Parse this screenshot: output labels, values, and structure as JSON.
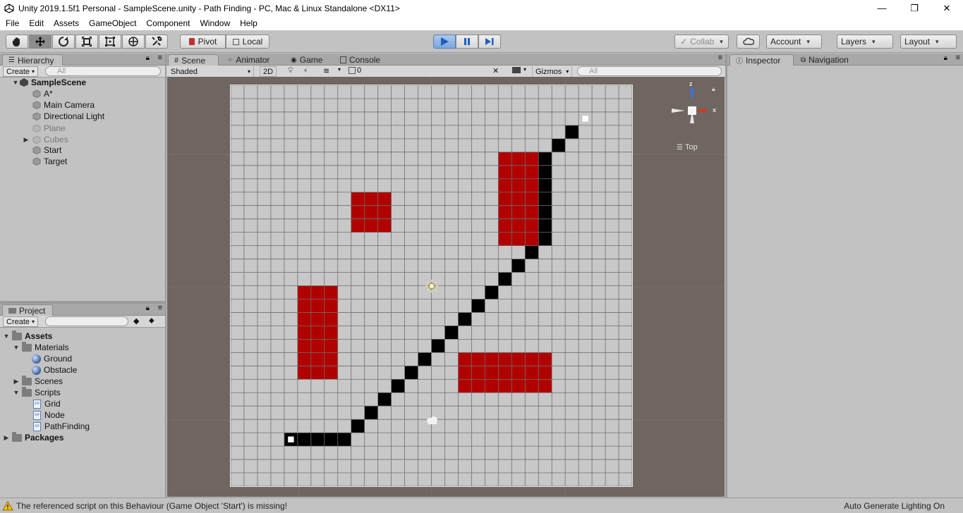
{
  "window": {
    "title": "Unity 2019.1.5f1 Personal - SampleScene.unity - Path Finding - PC, Mac & Linux Standalone <DX11>",
    "minimize": "—",
    "maximize": "❐",
    "close": "✕"
  },
  "menu": [
    "File",
    "Edit",
    "Assets",
    "GameObject",
    "Component",
    "Window",
    "Help"
  ],
  "toolbar": {
    "pivot_label": "Pivot",
    "local_label": "Local",
    "collab_label": "Collab",
    "account_label": "Account",
    "layers_label": "Layers",
    "layout_label": "Layout"
  },
  "hierarchy": {
    "tab_label": "Hierarchy",
    "create_label": "Create",
    "search_placeholder": "All",
    "scene_name": "SampleScene",
    "items": [
      {
        "label": "A*",
        "disabled": false
      },
      {
        "label": "Main Camera",
        "disabled": false
      },
      {
        "label": "Directional Light",
        "disabled": false
      },
      {
        "label": "Plane",
        "disabled": true
      },
      {
        "label": "Cubes",
        "disabled": true
      },
      {
        "label": "Start",
        "disabled": false
      },
      {
        "label": "Target",
        "disabled": false
      }
    ]
  },
  "project": {
    "tab_label": "Project",
    "create_label": "Create",
    "assets_label": "Assets",
    "materials_label": "Materials",
    "ground_label": "Ground",
    "obstacle_label": "Obstacle",
    "scenes_label": "Scenes",
    "scripts_label": "Scripts",
    "grid_label": "Grid",
    "node_label": "Node",
    "pathfinding_label": "PathFinding",
    "packages_label": "Packages",
    "cs_badge": "c#"
  },
  "scene": {
    "tabs": [
      "Scene",
      "Animator",
      "Game",
      "Console"
    ],
    "shading_label": "Shaded",
    "twod_label": "2D",
    "hidden_count": "0",
    "gizmos_label": "Gizmos",
    "search_placeholder": "All",
    "view_label": "Top",
    "axis_z": "z",
    "axis_x": "x"
  },
  "inspector": {
    "tabs": [
      "Inspector",
      "Navigation"
    ]
  },
  "status": {
    "warning_text": "The referenced script on this Behaviour (Game Object 'Start') is missing!",
    "lighting_text": "Auto Generate Lighting On"
  },
  "colors": {
    "obstacle": "#b00000",
    "path": "#000000",
    "ground": "#c8c8c8",
    "scene_bg": "#6f6561"
  },
  "grid_map": {
    "cols": 30,
    "rows": 30,
    "start": [
      4,
      26
    ],
    "target": [
      26,
      2
    ],
    "obstacles": [
      {
        "col": 9,
        "row": 8,
        "w": 3,
        "h": 3
      },
      {
        "col": 20,
        "row": 5,
        "w": 3,
        "h": 7
      },
      {
        "col": 5,
        "row": 15,
        "w": 3,
        "h": 7
      },
      {
        "col": 17,
        "row": 20,
        "w": 7,
        "h": 3
      }
    ],
    "path": [
      [
        4,
        26
      ],
      [
        5,
        26
      ],
      [
        6,
        26
      ],
      [
        7,
        26
      ],
      [
        8,
        26
      ],
      [
        9,
        25
      ],
      [
        10,
        24
      ],
      [
        11,
        23
      ],
      [
        12,
        22
      ],
      [
        13,
        21
      ],
      [
        14,
        20
      ],
      [
        15,
        19
      ],
      [
        16,
        18
      ],
      [
        17,
        17
      ],
      [
        18,
        16
      ],
      [
        19,
        15
      ],
      [
        20,
        14
      ],
      [
        21,
        13
      ],
      [
        22,
        12
      ],
      [
        23,
        11
      ],
      [
        23,
        10
      ],
      [
        23,
        9
      ],
      [
        23,
        8
      ],
      [
        23,
        7
      ],
      [
        23,
        6
      ],
      [
        23,
        5
      ],
      [
        24,
        4
      ],
      [
        25,
        3
      ]
    ]
  }
}
